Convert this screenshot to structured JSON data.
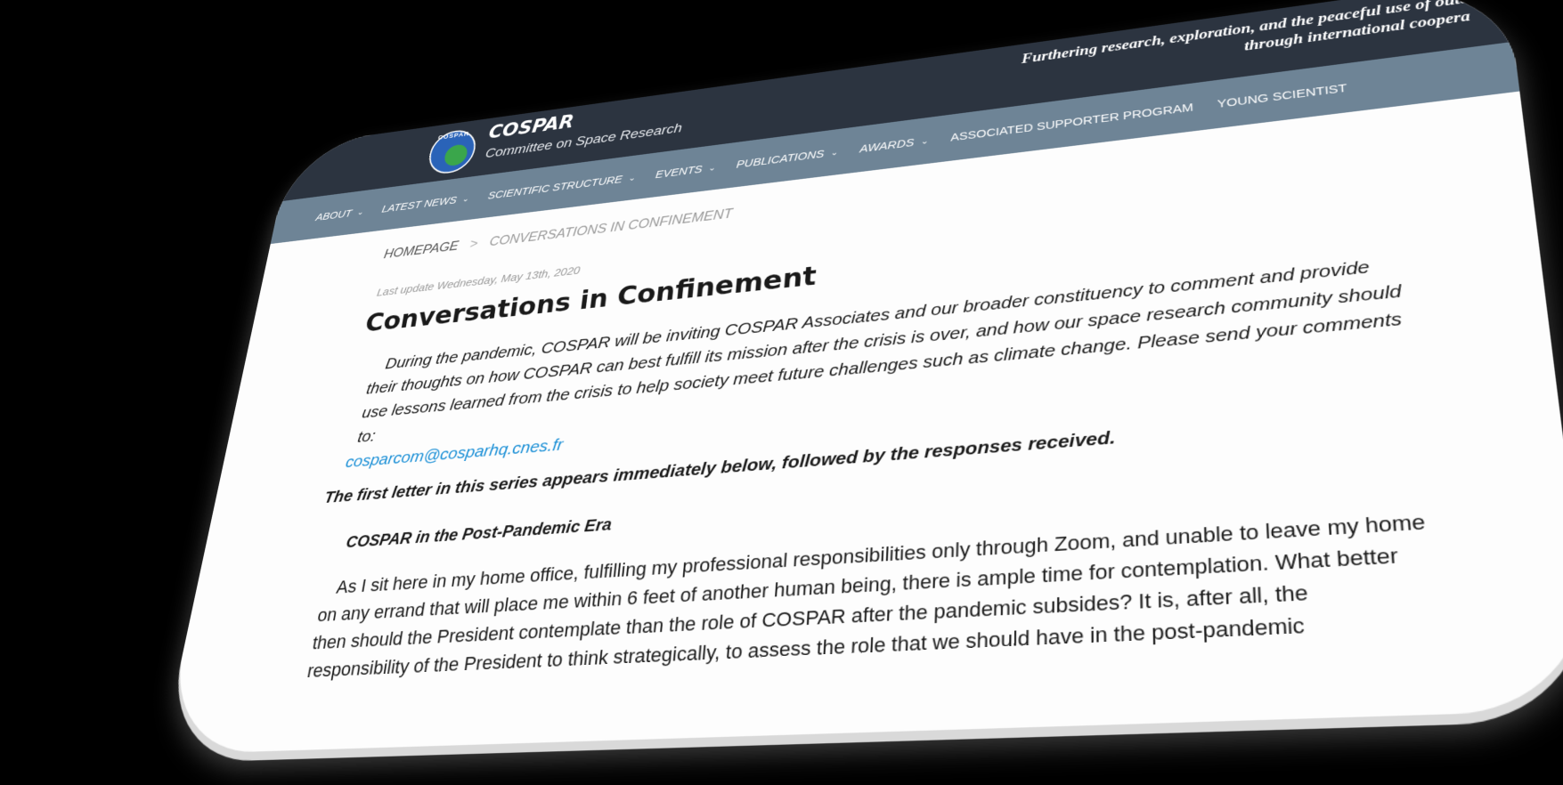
{
  "header": {
    "logo_text": "COSPAR",
    "brand": "COSPAR",
    "subtitle": "Committee on Space Research",
    "tagline_line1": "Furthering research, exploration, and the peaceful use of oute",
    "tagline_line2": "through international coopera"
  },
  "nav": {
    "items": [
      {
        "label": "ABOUT"
      },
      {
        "label": "LATEST NEWS"
      },
      {
        "label": "SCIENTIFIC STRUCTURE"
      },
      {
        "label": "EVENTS"
      },
      {
        "label": "PUBLICATIONS"
      },
      {
        "label": "AWARDS"
      },
      {
        "label": "ASSOCIATED SUPPORTER PROGRAM"
      },
      {
        "label": "YOUNG SCIENTIST"
      }
    ],
    "chevron": "⌄"
  },
  "breadcrumb": {
    "home": "HOMEPAGE",
    "separator": ">",
    "current": "CONVERSATIONS IN CONFINEMENT"
  },
  "article": {
    "updated": "Last update Wednesday, May 13th, 2020",
    "title": "Conversations in Confinement",
    "intro": "During the pandemic, COSPAR will be inviting COSPAR Associates and our broader constituency to comment and provide their thoughts on how COSPAR can best fulfill its mission after the crisis is over, and how our space research community should use lessons learned from the crisis to help society meet future challenges such as climate change. Please send your comments to:",
    "email": "cosparcom@cosparhq.cnes.fr",
    "lead": "The first letter in this series appears immediately below, followed by the responses received.",
    "subhead": "COSPAR in the Post-Pandemic Era",
    "body": "As I sit here in my home office, fulfilling my professional responsibilities only through Zoom, and unable to leave my home on any errand that will place me within 6 feet of another human being, there is ample time for contemplation. What better then should the President contemplate than the role of COSPAR after the pandemic subsides? It is, after all, the responsibility of the President to think strategically, to assess the role that we should have in the post-pandemic"
  }
}
